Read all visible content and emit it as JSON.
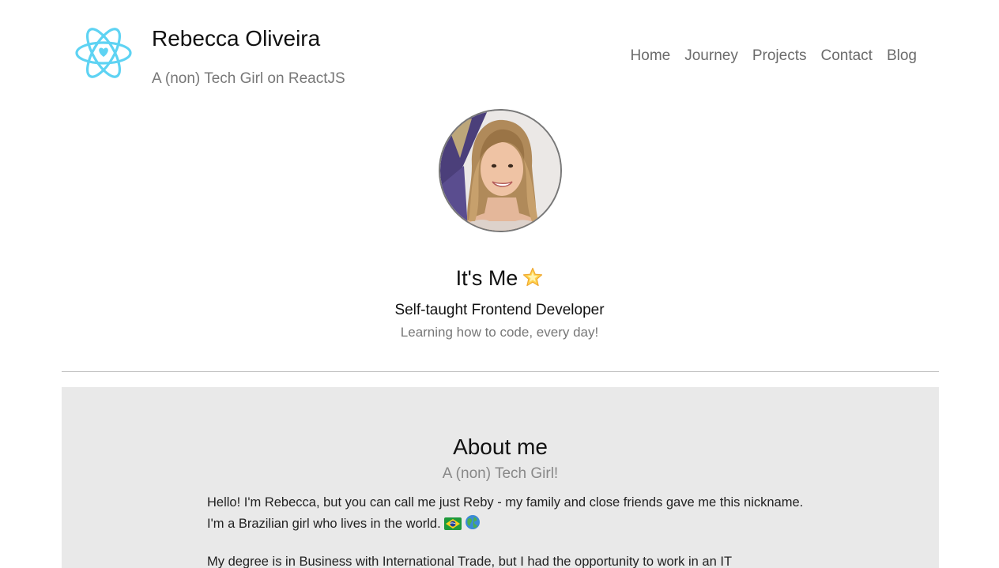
{
  "header": {
    "name": "Rebecca Oliveira",
    "tagline": "A (non) Tech Girl on ReactJS",
    "logo_icon": "react-atom-heart-icon",
    "accent_color": "#5ed3f3"
  },
  "nav": {
    "items": [
      {
        "label": "Home"
      },
      {
        "label": "Journey"
      },
      {
        "label": "Projects"
      },
      {
        "label": "Contact"
      },
      {
        "label": "Blog"
      }
    ]
  },
  "hero": {
    "avatar_icon": "profile-photo",
    "title": "It's Me",
    "title_emoji": "glowing-star-icon",
    "subtitle": "Self-taught Frontend Developer",
    "caption": "Learning how to code, every day!"
  },
  "about": {
    "title": "About me",
    "subtitle": "A (non) Tech Girl!",
    "paragraph_1": "Hello! I'm Rebecca, but you can call me just Reby - my family and close friends gave me this nickname. I'm a Brazilian girl who lives in the world.",
    "paragraph_1_icons": [
      "brazil-flag-icon",
      "globe-icon"
    ],
    "paragraph_2": "My degree is in Business with International Trade, but I had the opportunity to work in an IT",
    "background_color": "#e9e9e9"
  }
}
